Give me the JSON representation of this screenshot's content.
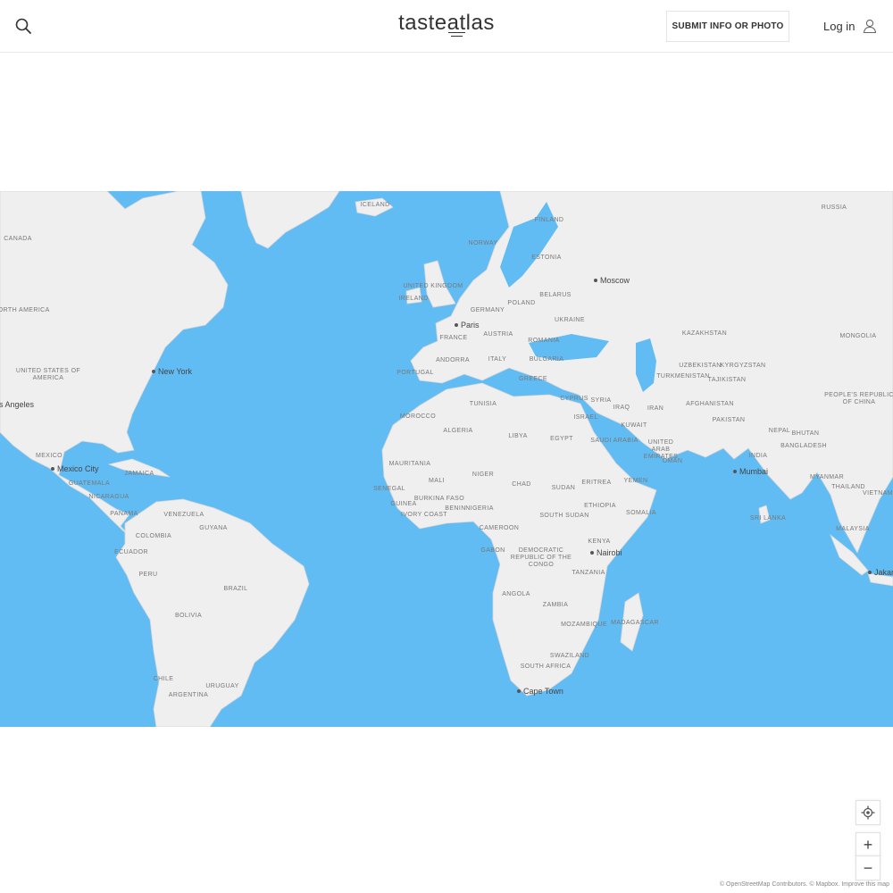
{
  "header": {
    "logo": {
      "part1": "taste",
      "part2": "at",
      "part3": "las"
    },
    "submit_label": "SUBMIT INFO OR PHOTO",
    "login_label": "Log in",
    "icons": {
      "search": "search-icon",
      "user": "user-icon"
    }
  },
  "map": {
    "colors": {
      "water": "#62bcf4",
      "land": "#efefef",
      "border": "#d6d6d6"
    },
    "countries": [
      "CANADA",
      "RUSSIA",
      "ICELAND",
      "FINLAND",
      "NORWAY",
      "ESTONIA",
      "UNITED KINGDOM",
      "IRELAND",
      "POLAND",
      "BELARUS",
      "GERMANY",
      "UKRAINE",
      "FRANCE",
      "AUSTRIA",
      "ROMANIA",
      "KAZAKHSTAN",
      "MONGOLIA",
      "ANDORRA",
      "ITALY",
      "BULGARIA",
      "PORTUGAL",
      "GREECE",
      "UZBEKISTAN",
      "KYRGYZSTAN",
      "TURKMENISTAN",
      "TAJIKISTAN",
      "NORTH AMERICA",
      "UNITED STATES OF AMERICA",
      "PEOPLE'S REPUBLIC OF CHINA",
      "TUNISIA",
      "CYPRUS",
      "SYRIA",
      "IRAQ",
      "IRAN",
      "AFGHANISTAN",
      "ISRAEL",
      "PAKISTAN",
      "MOROCCO",
      "ALGERIA",
      "LIBYA",
      "EGYPT",
      "KUWAIT",
      "SAUDI ARABIA",
      "NEPAL",
      "BHUTAN",
      "INDIA",
      "UNITED ARAB EMIRATES",
      "BANGLADESH",
      "OMAN",
      "MEXICO",
      "MAURITANIA",
      "MALI",
      "NIGER",
      "CHAD",
      "SUDAN",
      "ERITREA",
      "YEMEN",
      "MYANMAR",
      "JAMAICA",
      "GUATEMALA",
      "NICARAGUA",
      "SENEGAL",
      "BURKINA FASO",
      "GUINEA",
      "BENIN",
      "NIGERIA",
      "ETHIOPIA",
      "SOMALIA",
      "THAILAND",
      "VIETNAM",
      "PANAMA",
      "VENEZUELA",
      "IVORY COAST",
      "SOUTH SUDAN",
      "SRI LANKA",
      "GUYANA",
      "COLOMBIA",
      "CAMEROON",
      "MALAYSIA",
      "KENYA",
      "ECUADOR",
      "GABON",
      "DEMOCRATIC REPUBLIC OF THE CONGO",
      "TANZANIA",
      "PERU",
      "BRAZIL",
      "ANGOLA",
      "ZAMBIA",
      "BOLIVIA",
      "MOZAMBIQUE",
      "MADAGASCAR",
      "SWAZILAND",
      "SOUTH AFRICA",
      "CHILE",
      "URUGUAY",
      "ARGENTINA"
    ],
    "cities": [
      "Moscow",
      "Paris",
      "New York",
      "Los Angeles",
      "Mexico City",
      "Mumbai",
      "Nairobi",
      "Cape Town",
      "Jakarta"
    ]
  },
  "controls": {
    "locate_icon": "crosshair-icon",
    "zoom_in": "+",
    "zoom_out": "−"
  },
  "attribution": {
    "osm": "© OpenStreetMap Contributors.",
    "mapbox": "© Mapbox.",
    "improve": "Improve this map"
  }
}
